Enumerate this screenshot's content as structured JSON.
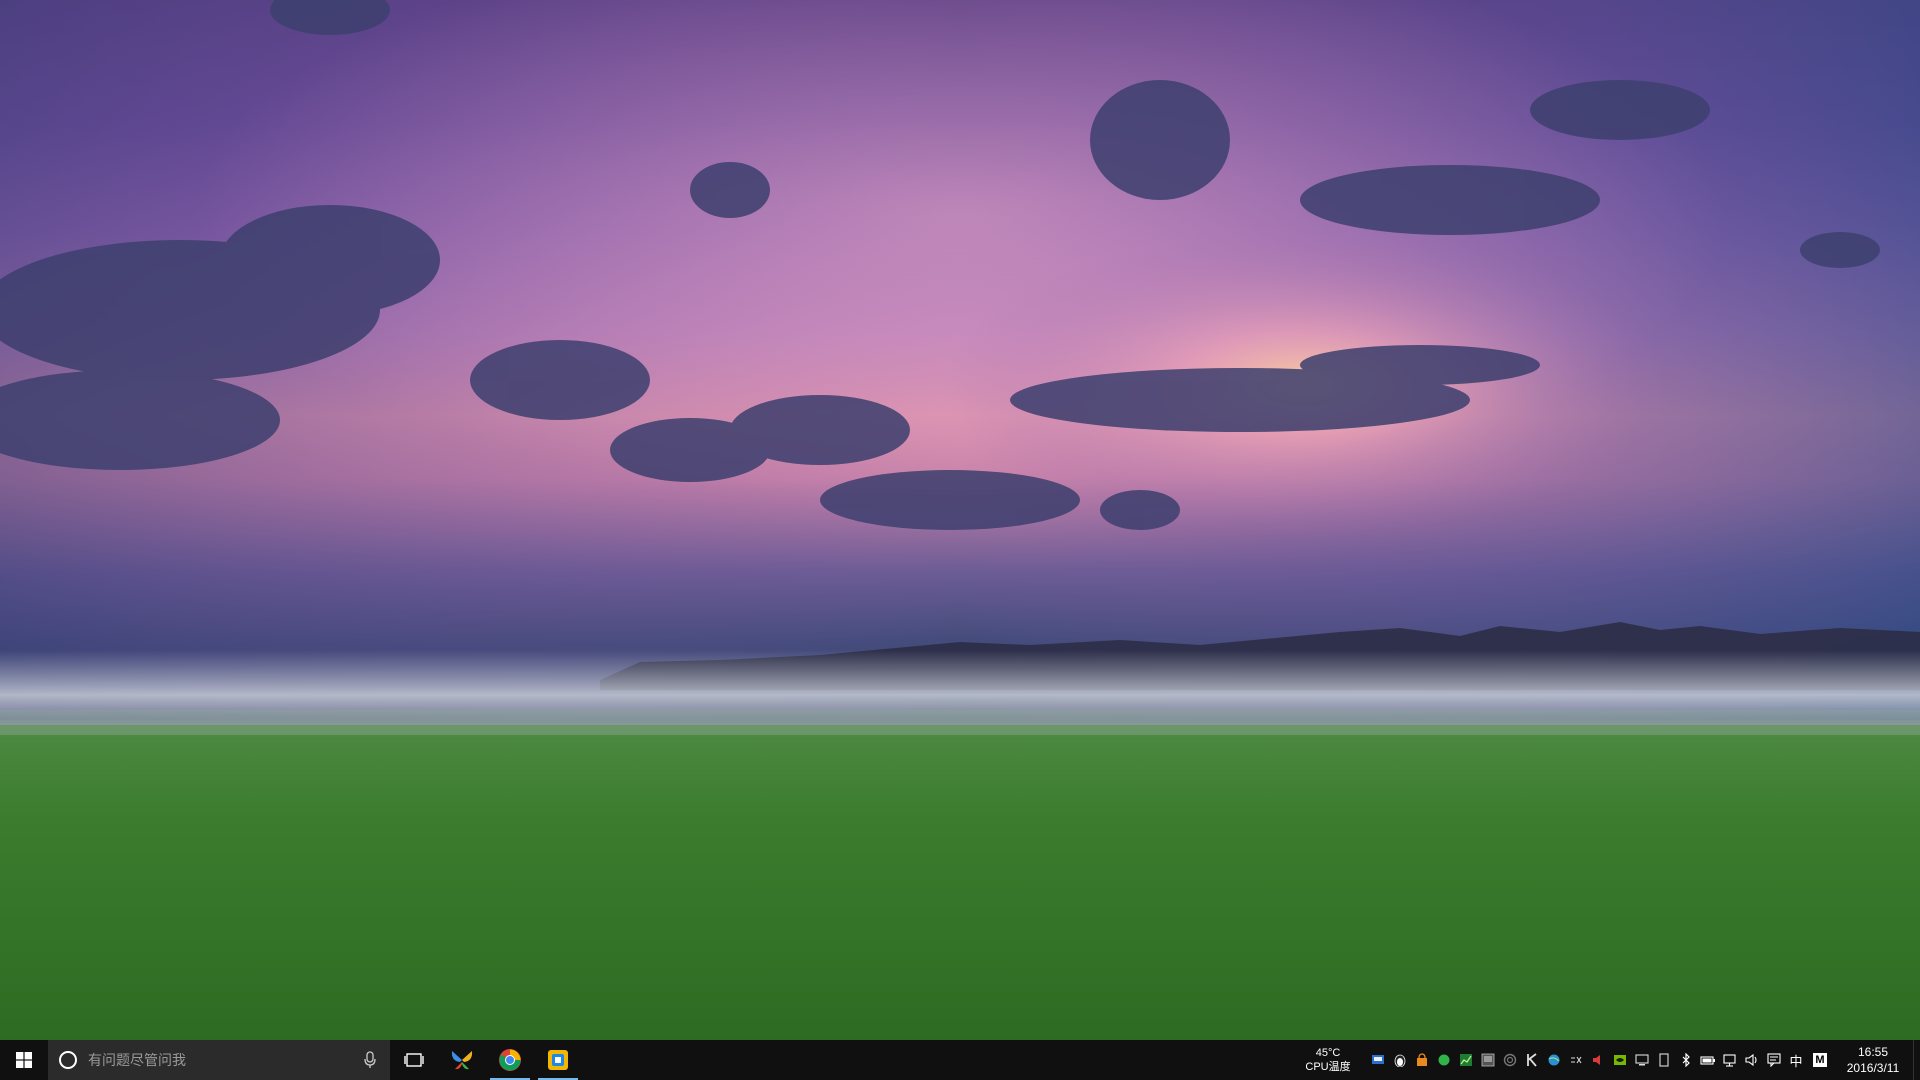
{
  "desktop": {
    "wallpaper": "purple-pink sunset sky over foggy green meadow with tree line"
  },
  "taskbar": {
    "search_placeholder": "有问题尽管问我",
    "apps": [
      {
        "name": "butterfly-app",
        "icon": "butterfly-icon",
        "running": false
      },
      {
        "name": "chrome",
        "icon": "chrome-icon",
        "running": true
      },
      {
        "name": "app-yellow-blue",
        "icon": "app-icon",
        "running": true
      }
    ],
    "cpu_widget": {
      "temp": "45°C",
      "label": "CPU温度"
    },
    "tray": {
      "ime_mode": "中",
      "ime_letter": "M"
    },
    "clock": {
      "time": "16:55",
      "date": "2016/3/11"
    }
  },
  "colors": {
    "taskbar_bg": "#101010",
    "search_bg": "#2b2b2b",
    "running_indicator": "#76b9ed"
  }
}
